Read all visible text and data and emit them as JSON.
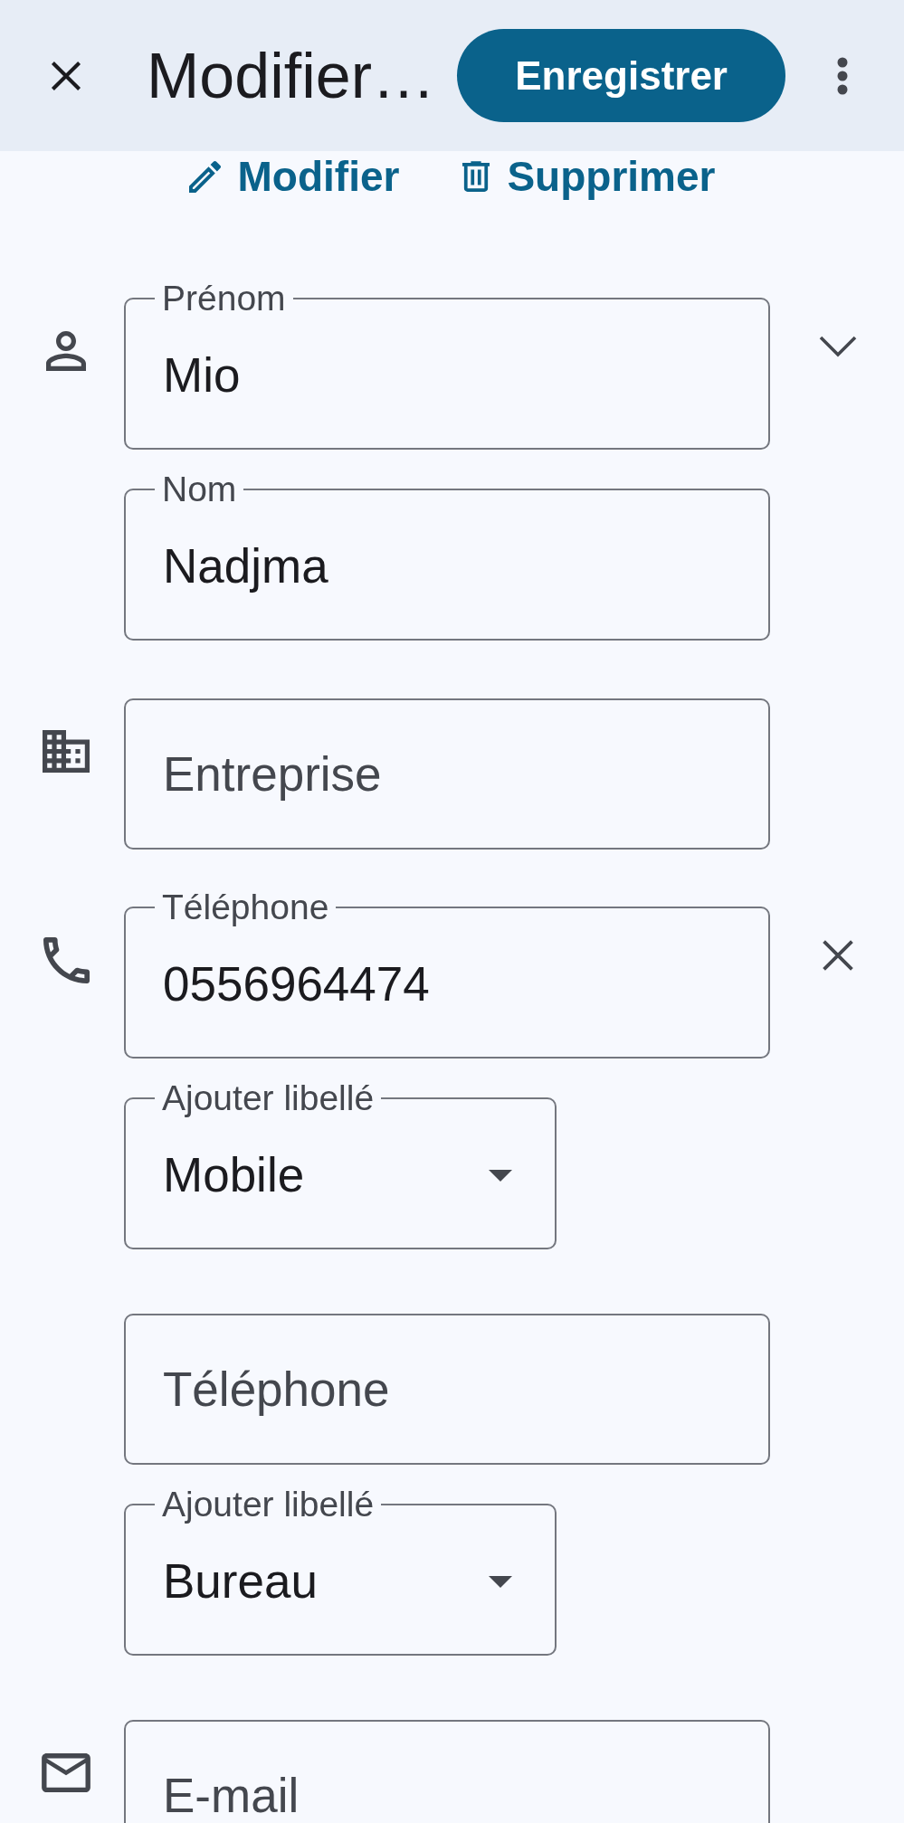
{
  "top_bar": {
    "title": "Modifier…",
    "save_button": "Enregistrer"
  },
  "actions": [
    {
      "kind": "edit",
      "label": "Modifier"
    },
    {
      "kind": "delete",
      "label": "Supprimer"
    }
  ],
  "sections": [
    {
      "kind": "name",
      "fields": [
        {
          "kind": "text",
          "label": "Prénom",
          "value": "Mio",
          "trailing": {
            "kind": "expand"
          }
        },
        {
          "kind": "text",
          "label": "Nom",
          "value": "Nadjma"
        }
      ]
    },
    {
      "kind": "company",
      "fields": [
        {
          "kind": "text",
          "placeholder": "Entreprise"
        }
      ]
    },
    {
      "kind": "phone",
      "fields": [
        {
          "kind": "text",
          "label": "Téléphone",
          "value": "0556964474",
          "trailing": {
            "kind": "clear"
          }
        },
        {
          "kind": "select",
          "label": "Ajouter libellé",
          "value": "Mobile"
        },
        {
          "kind": "text",
          "placeholder": "Téléphone"
        },
        {
          "kind": "select",
          "label": "Ajouter libellé",
          "value": "Bureau"
        }
      ]
    },
    {
      "kind": "email",
      "fields": [
        {
          "kind": "text",
          "placeholder": "E-mail"
        }
      ]
    }
  ]
}
